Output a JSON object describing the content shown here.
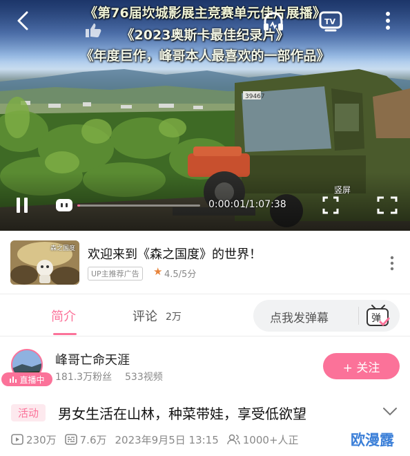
{
  "player": {
    "overlay_line1": "《第76届坎城影展主竞赛单元佳片展播》",
    "overlay_line2": "《2023奥斯卡最佳纪录片》",
    "overlay_line3": "《年度巨作，峰哥本人最喜欢的一部作品》",
    "time": "0:00:01/1:07:38",
    "fullscreen_vertical_label": "竖屏",
    "progress_fraction": 0.01,
    "scene_truck_plate": "39467"
  },
  "ad": {
    "title": "欢迎来到《森之国度》的世界！",
    "tag": "UP主推荐广告",
    "rating": "4.5/5分",
    "thumb_text": "森之国度"
  },
  "tabs": {
    "intro": "简介",
    "comments": "评论",
    "comments_count": "2万",
    "danmaku_placeholder": "点我发弹幕",
    "danmaku_button": "弹"
  },
  "uploader": {
    "name": "峰哥亡命天涯",
    "live_badge": "直播中",
    "followers": "181.3万粉丝",
    "videos": "533视频",
    "follow_label": "+ 关注"
  },
  "video": {
    "activity_tag": "活动",
    "title": "男女生活在山林，种菜带娃，享受低欲望",
    "views": "230万",
    "danmaku_count": "7.6万",
    "date": "2023年9月5日 13:15",
    "watching": "1000+人正",
    "watermark": "欧漫露"
  },
  "colors": {
    "accent": "#fb7299",
    "rating_star": "#e8843a",
    "watermark": "#3b7fd8"
  }
}
